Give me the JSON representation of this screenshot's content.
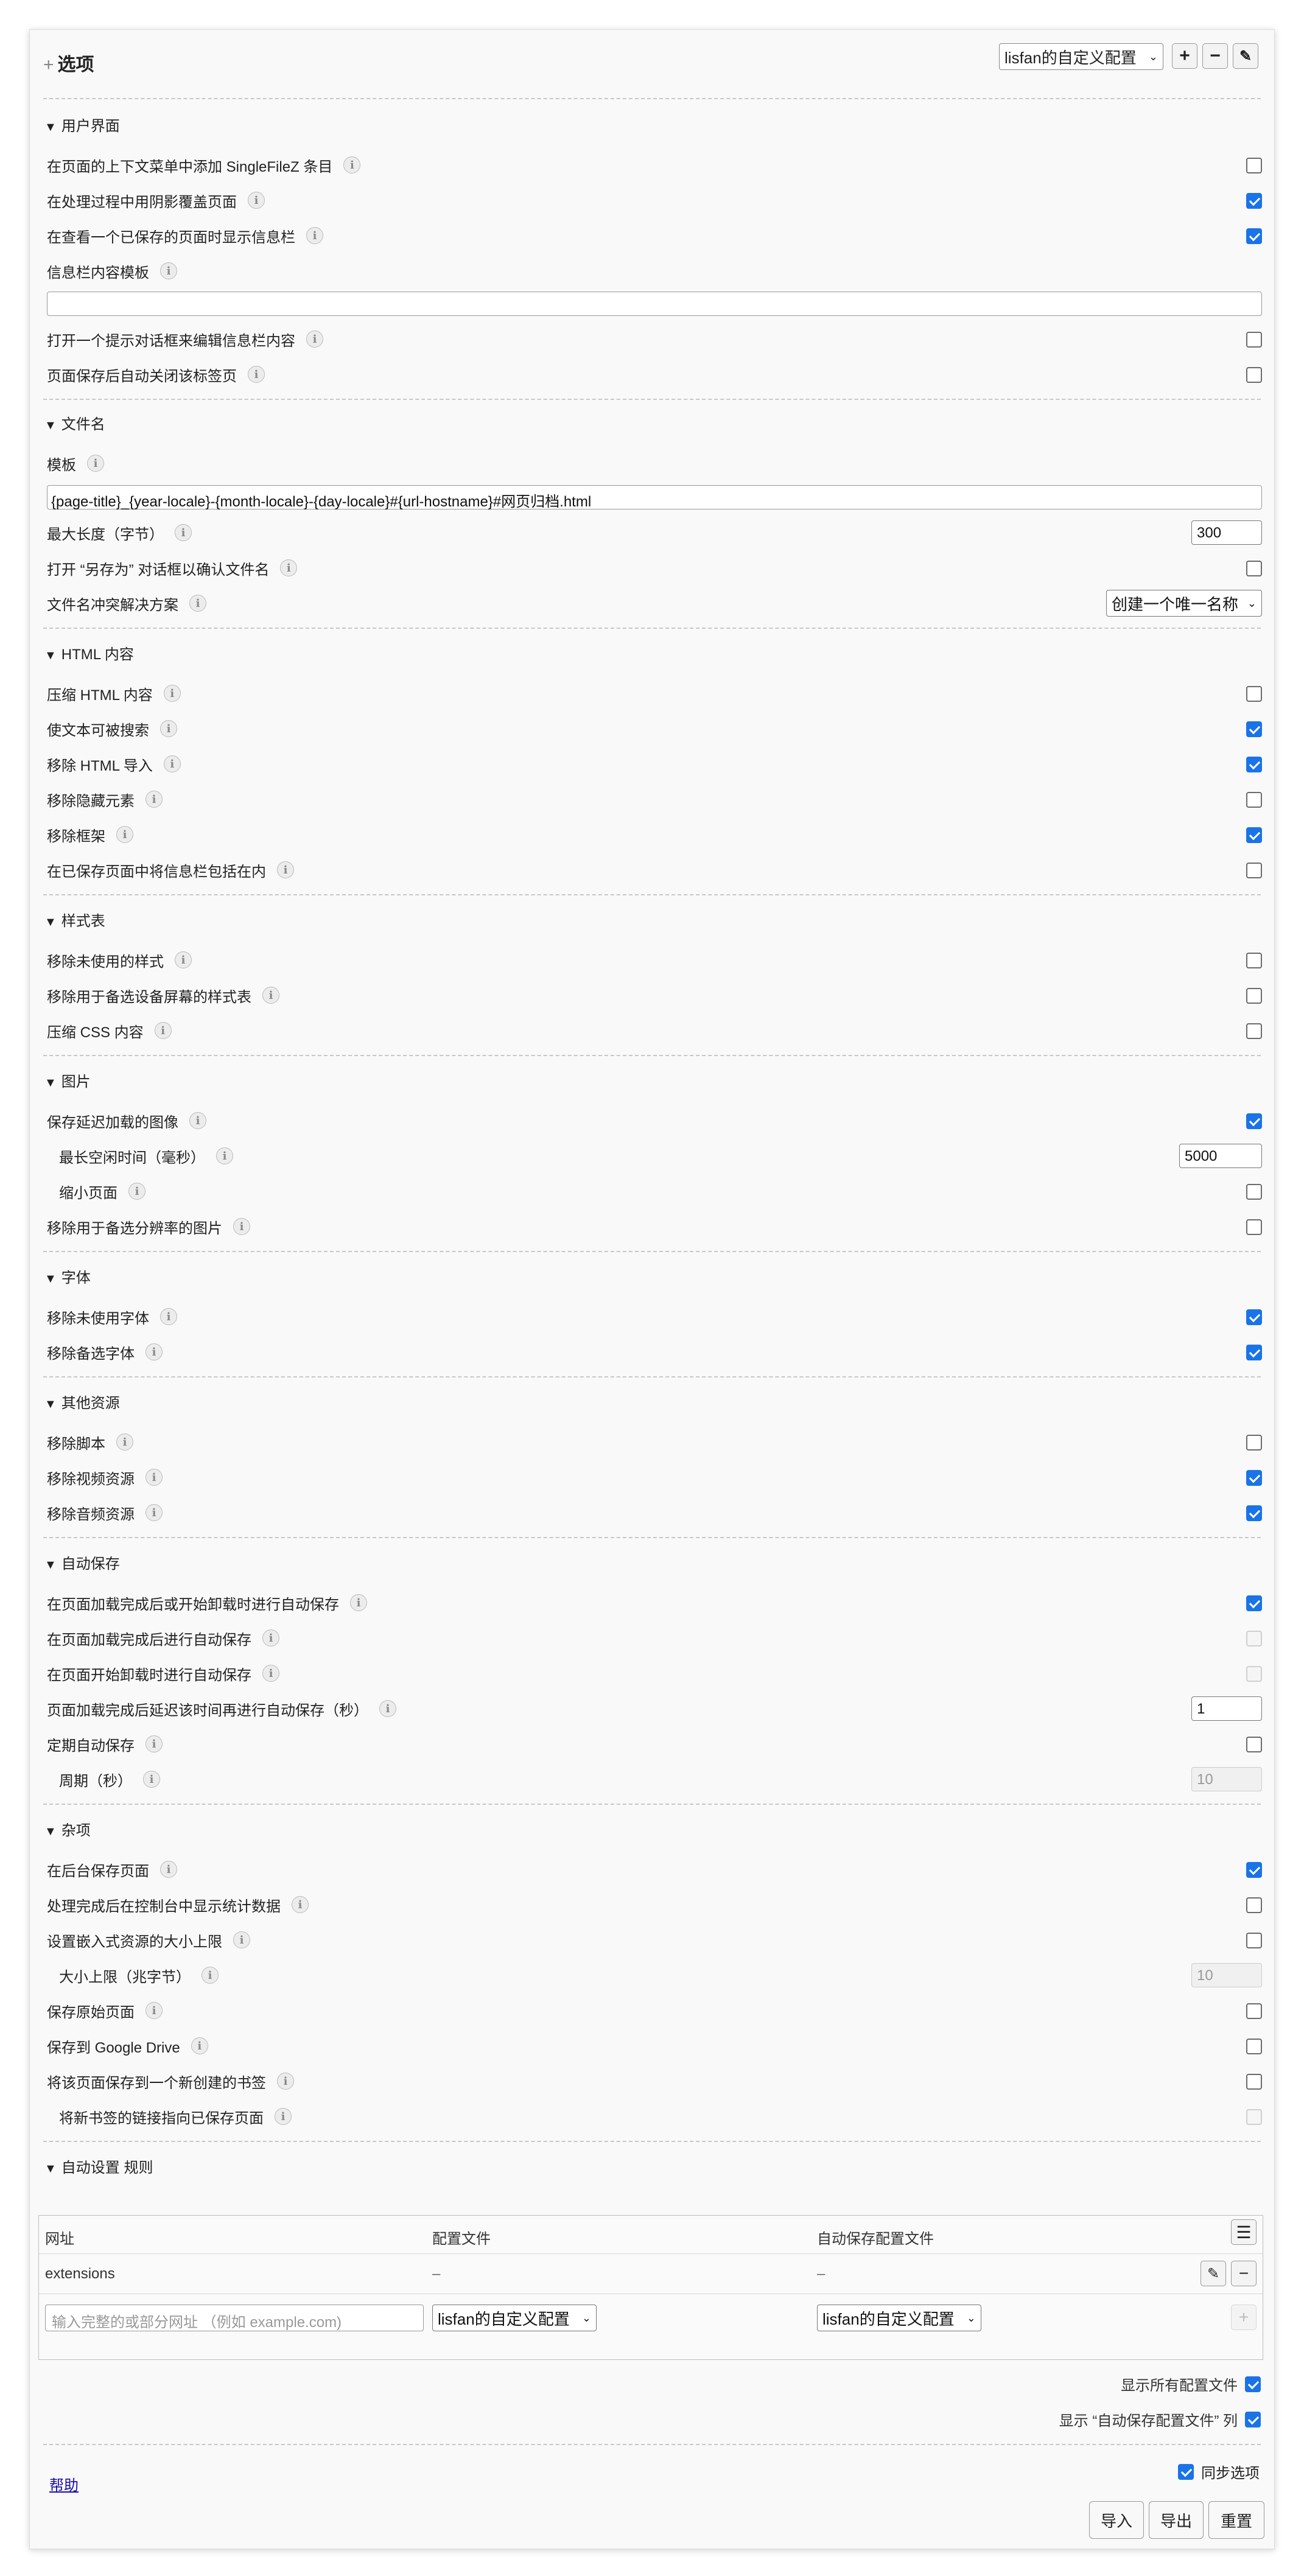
{
  "header": {
    "title": "选项",
    "profile": "lisfan的自定义配置",
    "add_label": "+",
    "remove_label": "−",
    "edit_label": "✎"
  },
  "ui": {
    "title": "用户界面",
    "context_menu": "在页面的上下文菜单中添加 SingleFileZ 条目",
    "shadow_overlay": "在处理过程中用阴影覆盖页面",
    "show_infobar": "在查看一个已保存的页面时显示信息栏",
    "infobar_template": "信息栏内容模板",
    "infobar_template_value": "",
    "prompt_infobar": "打开一个提示对话框来编辑信息栏内容",
    "close_tab": "页面保存后自动关闭该标签页"
  },
  "filename": {
    "title": "文件名",
    "template_label": "模板",
    "template_value": "{page-title}_{year-locale}-{month-locale}-{day-locale}#{url-hostname}#网页归档.html",
    "max_length_label": "最大长度（字节）",
    "max_length_value": "300",
    "save_as_label": "打开 “另存为” 对话框以确认文件名",
    "conflict_label": "文件名冲突解决方案",
    "conflict_value": "创建一个唯一名称"
  },
  "html": {
    "title": "HTML 内容",
    "compress": "压缩 HTML 内容",
    "searchable": "使文本可被搜索",
    "remove_imports": "移除 HTML 导入",
    "remove_hidden": "移除隐藏元素",
    "remove_frames": "移除框架",
    "include_infobar": "在已保存页面中将信息栏包括在内"
  },
  "styles": {
    "title": "样式表",
    "remove_unused": "移除未使用的样式",
    "remove_alt_media": "移除用于备选设备屏幕的样式表",
    "compress_css": "压缩 CSS 内容"
  },
  "images": {
    "title": "图片",
    "lazy": "保存延迟加载的图像",
    "idle_label": "最长空闲时间（毫秒）",
    "idle_value": "5000",
    "shrink": "缩小页面",
    "remove_alt": "移除用于备选分辨率的图片"
  },
  "fonts": {
    "title": "字体",
    "remove_unused": "移除未使用字体",
    "remove_alt": "移除备选字体"
  },
  "resources": {
    "title": "其他资源",
    "remove_scripts": "移除脚本",
    "remove_video": "移除视频资源",
    "remove_audio": "移除音频资源"
  },
  "autosave": {
    "title": "自动保存",
    "load_or_unload": "在页面加载完成后或开始卸载时进行自动保存",
    "after_load": "在页面加载完成后进行自动保存",
    "on_unload": "在页面开始卸载时进行自动保存",
    "delay_label": "页面加载完成后延迟该时间再进行自动保存（秒）",
    "delay_value": "1",
    "periodic": "定期自动保存",
    "period_label": "周期（秒）",
    "period_value": "10"
  },
  "misc": {
    "title": "杂项",
    "background": "在后台保存页面",
    "stats": "处理完成后在控制台中显示统计数据",
    "size_limit": "设置嵌入式资源的大小上限",
    "size_limit_label": "大小上限（兆字节）",
    "size_limit_value": "10",
    "save_original": "保存原始页面",
    "google_drive": "保存到 Google Drive",
    "bookmark": "将该页面保存到一个新创建的书签",
    "bookmark_link": "将新书签的链接指向已保存页面"
  },
  "rules": {
    "title": "自动设置 规则",
    "col_url": "网址",
    "col_profile": "配置文件",
    "col_autosave": "自动保存配置文件",
    "row_url": "extensions",
    "row_profile": "–",
    "row_autosave": "–",
    "new_url_placeholder": "输入完整的或部分网址 （例如 example.com)",
    "new_profile": "lisfan的自定义配置",
    "new_autosave": "lisfan的自定义配置",
    "show_all_profiles": "显示所有配置文件",
    "show_autosave_col": "显示 “自动保存配置文件” 列"
  },
  "footer": {
    "help": "帮助",
    "sync": "同步选项",
    "import": "导入",
    "export": "导出",
    "reset": "重置"
  },
  "icons": {
    "info": "info-icon",
    "menu": "menu-icon",
    "edit": "pencil-icon"
  },
  "colors": {
    "accent": "#1a73e8",
    "link": "#1a0dab"
  }
}
